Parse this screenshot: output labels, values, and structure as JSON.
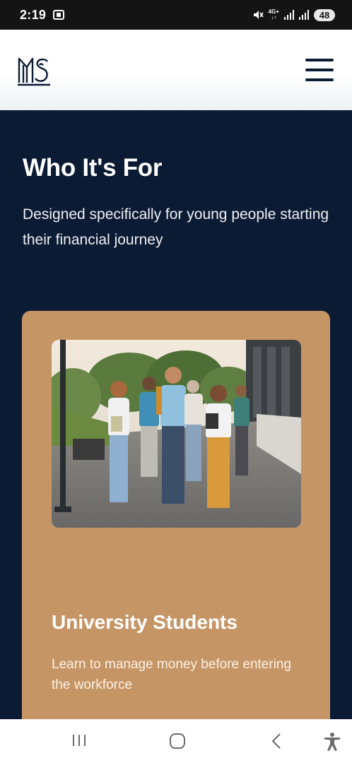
{
  "status_bar": {
    "time": "2:19",
    "network": "4G+",
    "battery": "48"
  },
  "header": {
    "logo": "ms-monogram-logo",
    "menu_icon": "hamburger-menu-icon"
  },
  "section": {
    "title": "Who It's For",
    "subtitle": "Designed specifically for young people starting their financial journey"
  },
  "card": {
    "image": "group of students walking on campus",
    "title": "University Students",
    "description": "Learn to manage money before entering the workforce"
  },
  "nav_bar": {
    "items": [
      "recent-apps-icon",
      "home-icon",
      "back-icon",
      "accessibility-icon"
    ]
  },
  "colors": {
    "navy": "#0b1b33",
    "card": "#c69565",
    "white": "#ffffff"
  }
}
